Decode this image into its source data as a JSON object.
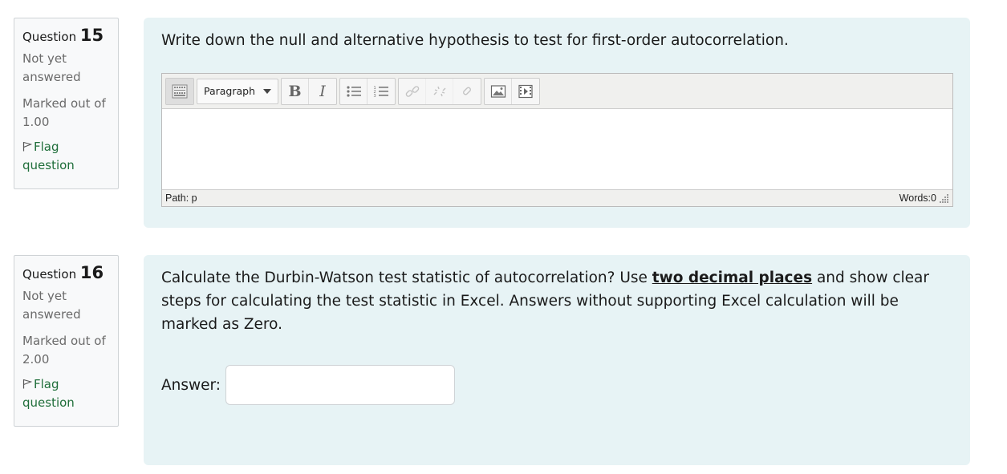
{
  "questions": [
    {
      "label": "Question",
      "number": "15",
      "state": "Not yet answered",
      "marked_out_of_label": "Marked out of",
      "marked_out_of_value": "1.00",
      "flag_label": "Flag question",
      "text": "Write down the null and alternative hypothesis to test for first-order autocorrelation.",
      "editor": {
        "format_select": "Paragraph",
        "path": "Path: p",
        "words": "Words:0",
        "toolbar_icons": [
          "toolbar-toggle-icon",
          "bold-icon",
          "italic-icon",
          "bullet-list-icon",
          "numbered-list-icon",
          "link-icon",
          "unlink-icon",
          "anchor-icon",
          "image-icon",
          "media-icon"
        ]
      }
    },
    {
      "label": "Question",
      "number": "16",
      "state": "Not yet answered",
      "marked_out_of_label": "Marked out of",
      "marked_out_of_value": "2.00",
      "flag_label": "Flag question",
      "text_before": "Calculate the Durbin-Watson test statistic of autocorrelation? Use ",
      "text_emphasis": "two decimal places",
      "text_after": " and show clear steps for calculating the test statistic in Excel. Answers without supporting Excel calculation will be marked as Zero.",
      "answer_label": "Answer:",
      "answer_value": ""
    }
  ],
  "colors": {
    "content_bg": "#e7f3f5",
    "info_bg": "#f8f9fa",
    "flag_link": "#1f6e3a"
  }
}
